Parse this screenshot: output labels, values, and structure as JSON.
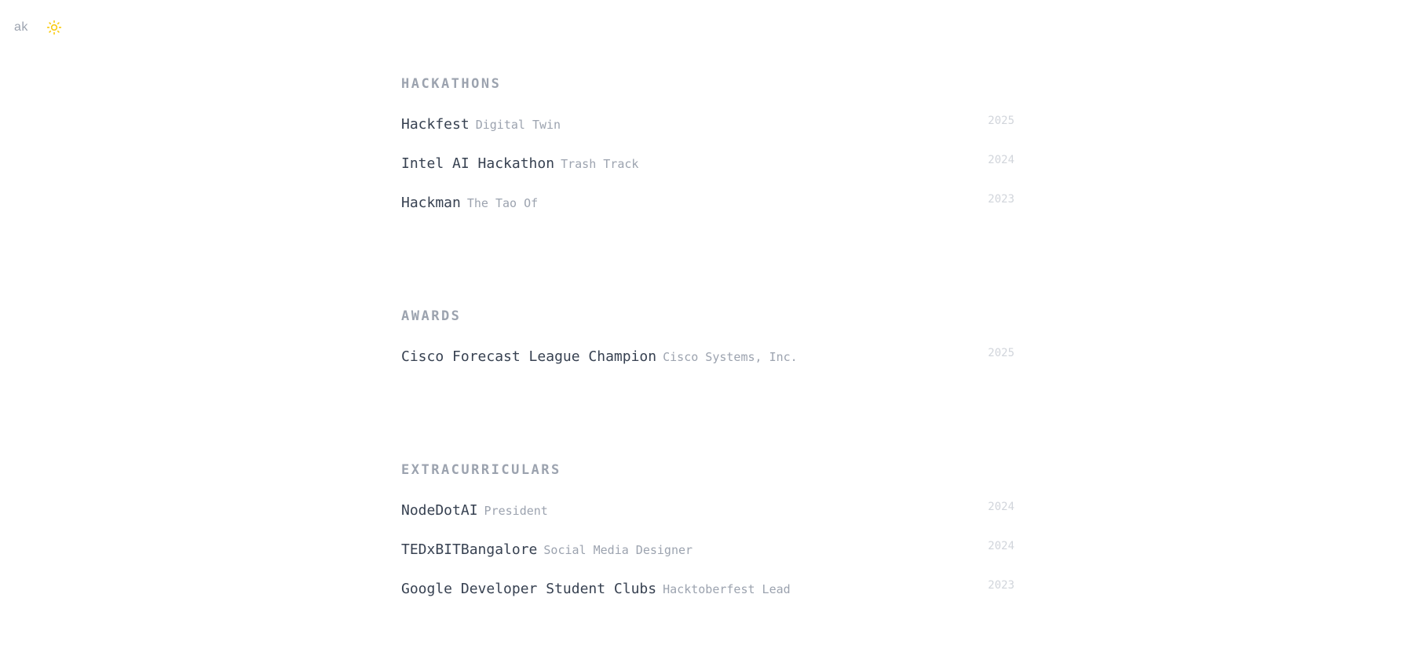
{
  "header": {
    "logo": "ak",
    "theme_icon": "sun-icon",
    "theme_icon_color": "#facc15"
  },
  "sections": [
    {
      "title": "HACKATHONS",
      "items": [
        {
          "name": "Hackfest",
          "sub": "Digital Twin",
          "year": "2025"
        },
        {
          "name": "Intel AI Hackathon",
          "sub": "Trash Track",
          "year": "2024"
        },
        {
          "name": "Hackman",
          "sub": "The Tao Of",
          "year": "2023"
        }
      ]
    },
    {
      "title": "AWARDS",
      "items": [
        {
          "name": "Cisco Forecast League Champion",
          "sub": "Cisco Systems, Inc.",
          "year": "2025"
        }
      ]
    },
    {
      "title": "EXTRACURRICULARS",
      "items": [
        {
          "name": "NodeDotAI",
          "sub": "President",
          "year": "2024"
        },
        {
          "name": "TEDxBITBangalore",
          "sub": "Social Media Designer",
          "year": "2024"
        },
        {
          "name": "Google Developer Student Clubs",
          "sub": "Hacktoberfest Lead",
          "year": "2023"
        }
      ]
    }
  ],
  "colors": {
    "heading": "#9ca3af",
    "primary_text": "#374151",
    "muted_text": "#9ca3af",
    "year_text": "#d1d5db"
  }
}
